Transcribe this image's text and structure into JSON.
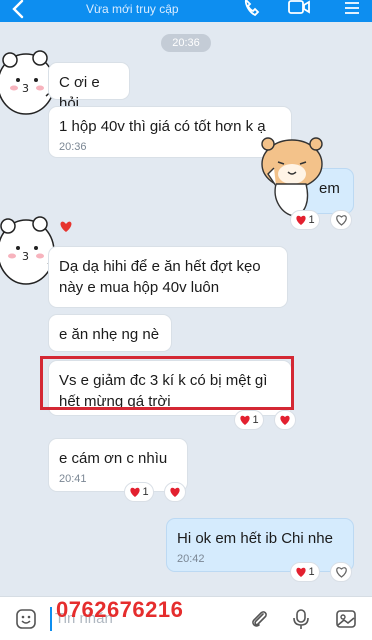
{
  "header": {
    "status": "Vừa mới truy cập",
    "accent": "#0d8ef0"
  },
  "chat": {
    "date_pill": "20:36",
    "messages": [
      {
        "from": "them",
        "text": "C ơi e hỏi"
      },
      {
        "from": "them",
        "text": "1 hộp 40v thì giá có tốt hơn k ạ",
        "time": "20:36"
      },
      {
        "from": "me",
        "text": "em",
        "reactions": {
          "emoji": "heart",
          "count": "1"
        }
      },
      {
        "from": "them",
        "text": "Dạ dạ hihi để e ăn hết đợt kẹo này e mua hộp 40v luôn"
      },
      {
        "from": "them",
        "text": "e ăn nhẹ ng nè"
      },
      {
        "from": "them",
        "text": "Vs e giảm đc 3 kí k có bị mệt gì hết mừng qá trời",
        "highlighted": true,
        "reactions": {
          "emoji": "heart",
          "count": "1"
        }
      },
      {
        "from": "them",
        "text": "e cám ơn c nhìu",
        "time": "20:41",
        "reactions": {
          "emoji": "heart",
          "count": "1"
        }
      },
      {
        "from": "me",
        "text": "Hi ok em hết ib Chi nhe",
        "time": "20:42",
        "reactions": {
          "emoji": "heart",
          "count": "1"
        }
      }
    ]
  },
  "composer": {
    "placeholder": "Tin nhắn",
    "overlay_phone": "0762676216",
    "highlight_color": "#d42834"
  }
}
